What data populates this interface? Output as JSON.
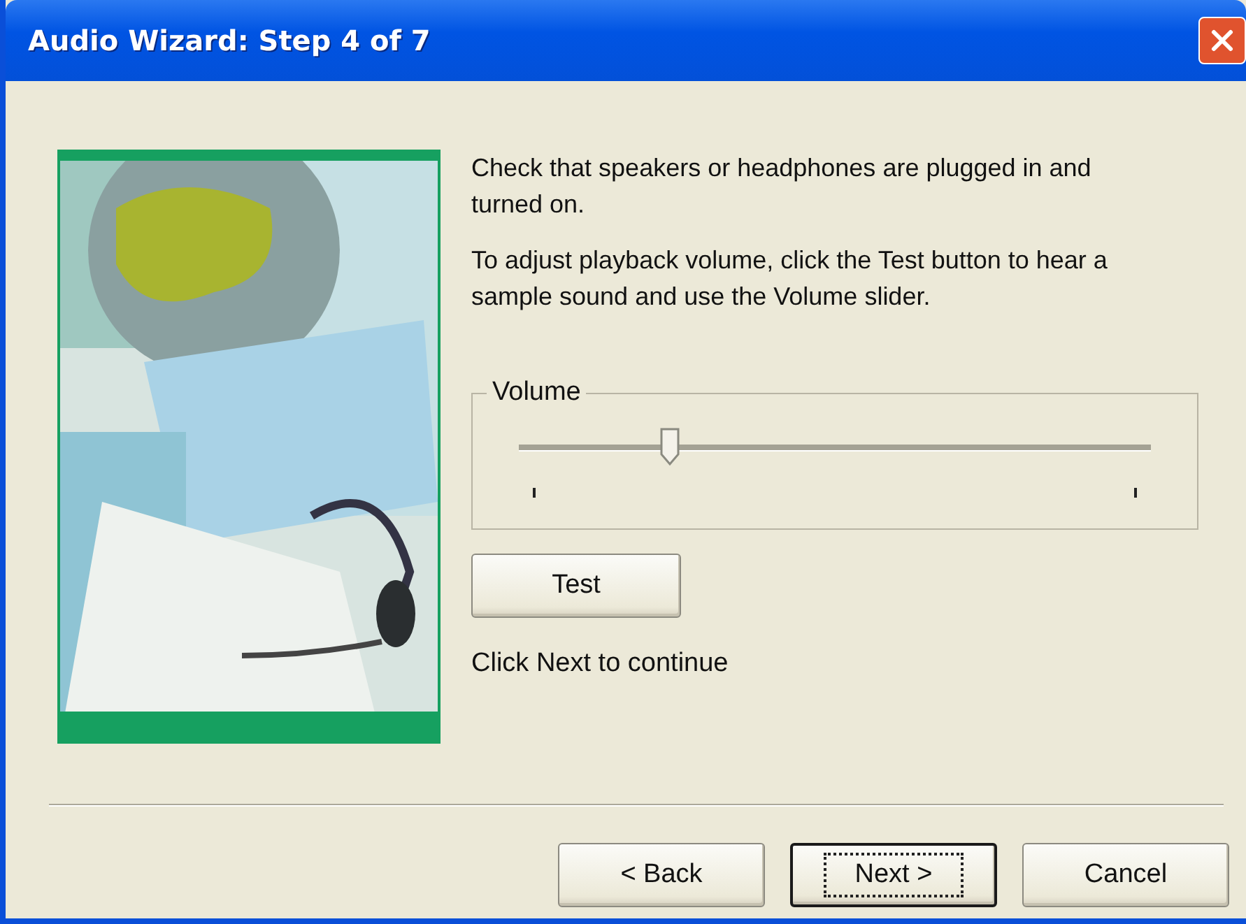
{
  "window": {
    "title": "Audio Wizard: Step 4 of 7"
  },
  "picture": {
    "kind": "picture"
  },
  "instructions": [
    "Check that speakers or headphones are plugged in and turned on.",
    "To adjust playback volume, click the Test button to hear a sample sound and use the Volume slider."
  ],
  "volume": {
    "label": "Volume",
    "level": 0.24
  },
  "test_button": {
    "label": "Test"
  },
  "hint": "Click Next to continue",
  "buttons": [
    {
      "label": "< Back",
      "default": false
    },
    {
      "label": "Next >",
      "default": true
    },
    {
      "label": "Cancel",
      "default": false
    }
  ]
}
